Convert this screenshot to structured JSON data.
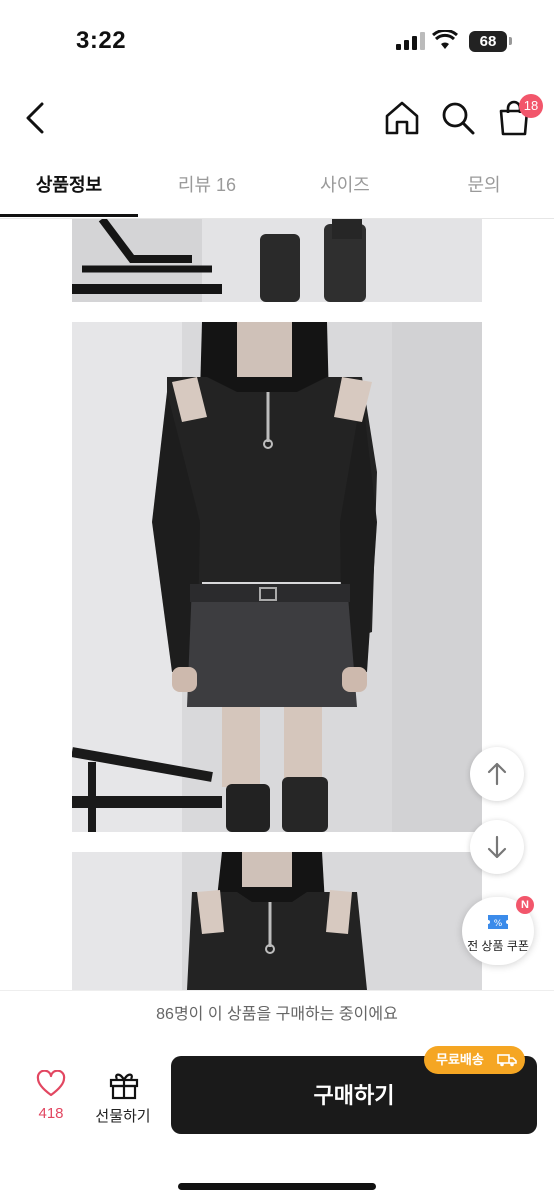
{
  "status_bar": {
    "time": "3:22",
    "battery": "68"
  },
  "header": {
    "cart_count": "18"
  },
  "tabs": [
    {
      "label": "상품정보",
      "active": true
    },
    {
      "label": "리뷰 16",
      "active": false
    },
    {
      "label": "사이즈",
      "active": false
    },
    {
      "label": "문의",
      "active": false
    }
  ],
  "icons": {
    "back": "chevron-left-icon",
    "home": "home-icon",
    "search": "search-icon",
    "cart": "shopping-bag-icon",
    "scroll_up": "arrow-up-icon",
    "scroll_down": "arrow-down-icon",
    "coupon": "ticket-icon",
    "like": "heart-icon",
    "gift": "gift-icon",
    "truck": "truck-icon"
  },
  "coupon": {
    "label": "전 상품 쿠폰",
    "new_badge": "N"
  },
  "notice": {
    "text": "86명이 이 상품을 구매하는 중이에요"
  },
  "bottom_bar": {
    "like_count": "418",
    "gift_label": "선물하기",
    "buy_label": "구매하기",
    "free_shipping": "무료배송"
  },
  "colors": {
    "accent": "#f2566b",
    "shipping": "#f5a623",
    "buy_button": "#1a1a1a"
  }
}
